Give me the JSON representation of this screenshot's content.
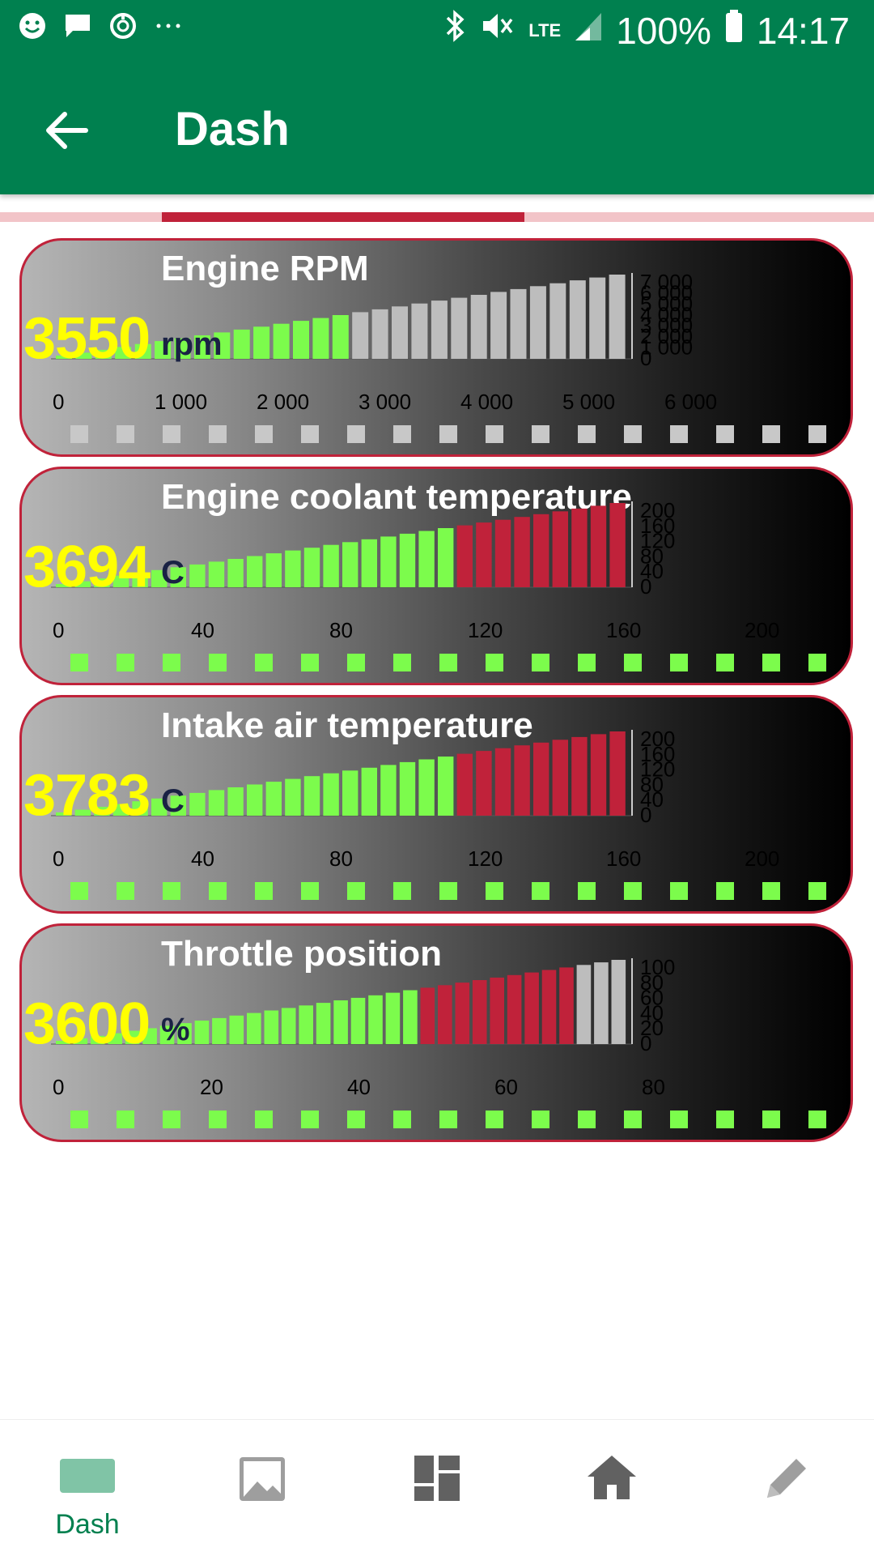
{
  "status_bar": {
    "battery": "100%",
    "time": "14:17",
    "network": "LTE",
    "icons": [
      "smiley-icon",
      "message-icon",
      "sync-icon",
      "more-dots-icon",
      "bluetooth-icon",
      "mute-icon",
      "signal-icon",
      "battery-icon"
    ]
  },
  "app_bar": {
    "title": "Dash",
    "back_icon": "arrow-left-icon"
  },
  "colors": {
    "primary": "#00804f",
    "accent": "#c0223a",
    "value": "#ffff00",
    "bar_green": "#7cfc4c",
    "bar_red": "#c0223a",
    "bar_gray": "#bdbdbd"
  },
  "gauges": [
    {
      "title": "Engine RPM",
      "value": "3550",
      "unit": "rpm",
      "ticks": [
        "0",
        "1 000",
        "2 000",
        "3 000",
        "4 000",
        "5 000",
        "6 000"
      ],
      "scale": [
        "7 000",
        "6 000",
        "5 000",
        "4 000",
        "3 000",
        "2 000",
        "1 000",
        "0"
      ],
      "bars": 29,
      "bar_colors": [
        "green",
        "green",
        "green",
        "green",
        "green",
        "green",
        "green",
        "green",
        "green",
        "green",
        "green",
        "green",
        "green",
        "green",
        "green",
        "gray",
        "gray",
        "gray",
        "gray",
        "gray",
        "gray",
        "gray",
        "gray",
        "gray",
        "gray",
        "gray",
        "gray",
        "gray",
        "gray"
      ],
      "led_colors": [
        "gray",
        "gray",
        "gray",
        "gray",
        "gray",
        "gray",
        "gray",
        "gray",
        "gray",
        "gray",
        "gray",
        "gray",
        "gray",
        "gray",
        "gray",
        "gray",
        "gray"
      ]
    },
    {
      "title": "Engine coolant temperature",
      "value": "3694",
      "unit": "C",
      "ticks": [
        "0",
        "40",
        "80",
        "120",
        "160",
        "200"
      ],
      "scale": [
        "200",
        "160",
        "120",
        "80",
        "40",
        "0"
      ],
      "bars": 30,
      "bar_colors": [
        "green",
        "green",
        "green",
        "green",
        "green",
        "green",
        "green",
        "green",
        "green",
        "green",
        "green",
        "green",
        "green",
        "green",
        "green",
        "green",
        "green",
        "green",
        "green",
        "green",
        "green",
        "red",
        "red",
        "red",
        "red",
        "red",
        "red",
        "red",
        "red",
        "red"
      ],
      "led_colors": [
        "green",
        "green",
        "green",
        "green",
        "green",
        "green",
        "green",
        "green",
        "green",
        "green",
        "green",
        "green",
        "green",
        "green",
        "green",
        "green",
        "green"
      ]
    },
    {
      "title": "Intake air temperature",
      "value": "3783",
      "unit": "C",
      "ticks": [
        "0",
        "40",
        "80",
        "120",
        "160",
        "200"
      ],
      "scale": [
        "200",
        "160",
        "120",
        "80",
        "40",
        "0"
      ],
      "bars": 30,
      "bar_colors": [
        "green",
        "green",
        "green",
        "green",
        "green",
        "green",
        "green",
        "green",
        "green",
        "green",
        "green",
        "green",
        "green",
        "green",
        "green",
        "green",
        "green",
        "green",
        "green",
        "green",
        "green",
        "red",
        "red",
        "red",
        "red",
        "red",
        "red",
        "red",
        "red",
        "red"
      ],
      "led_colors": [
        "green",
        "green",
        "green",
        "green",
        "green",
        "green",
        "green",
        "green",
        "green",
        "green",
        "green",
        "green",
        "green",
        "green",
        "green",
        "green",
        "green"
      ]
    },
    {
      "title": "Throttle position",
      "value": "3600",
      "unit": "%",
      "ticks": [
        "0",
        "20",
        "40",
        "60",
        "80"
      ],
      "scale": [
        "100",
        "80",
        "60",
        "40",
        "20",
        "0"
      ],
      "bars": 33,
      "bar_colors": [
        "green",
        "green",
        "green",
        "green",
        "green",
        "green",
        "green",
        "green",
        "green",
        "green",
        "green",
        "green",
        "green",
        "green",
        "green",
        "green",
        "green",
        "green",
        "green",
        "green",
        "green",
        "red",
        "red",
        "red",
        "red",
        "red",
        "red",
        "red",
        "red",
        "red",
        "gray",
        "gray",
        "gray"
      ],
      "led_colors": [
        "green",
        "green",
        "green",
        "green",
        "green",
        "green",
        "green",
        "green",
        "green",
        "green",
        "green",
        "green",
        "green",
        "green",
        "green",
        "green",
        "green"
      ]
    }
  ],
  "bottom_nav": [
    {
      "label": "Dash",
      "icon": "dash-tab-icon",
      "active": true
    },
    {
      "label": "",
      "icon": "image-icon",
      "active": false
    },
    {
      "label": "",
      "icon": "dashboard-grid-icon",
      "active": false
    },
    {
      "label": "",
      "icon": "home-icon",
      "active": false
    },
    {
      "label": "",
      "icon": "pencil-icon",
      "active": false
    }
  ]
}
